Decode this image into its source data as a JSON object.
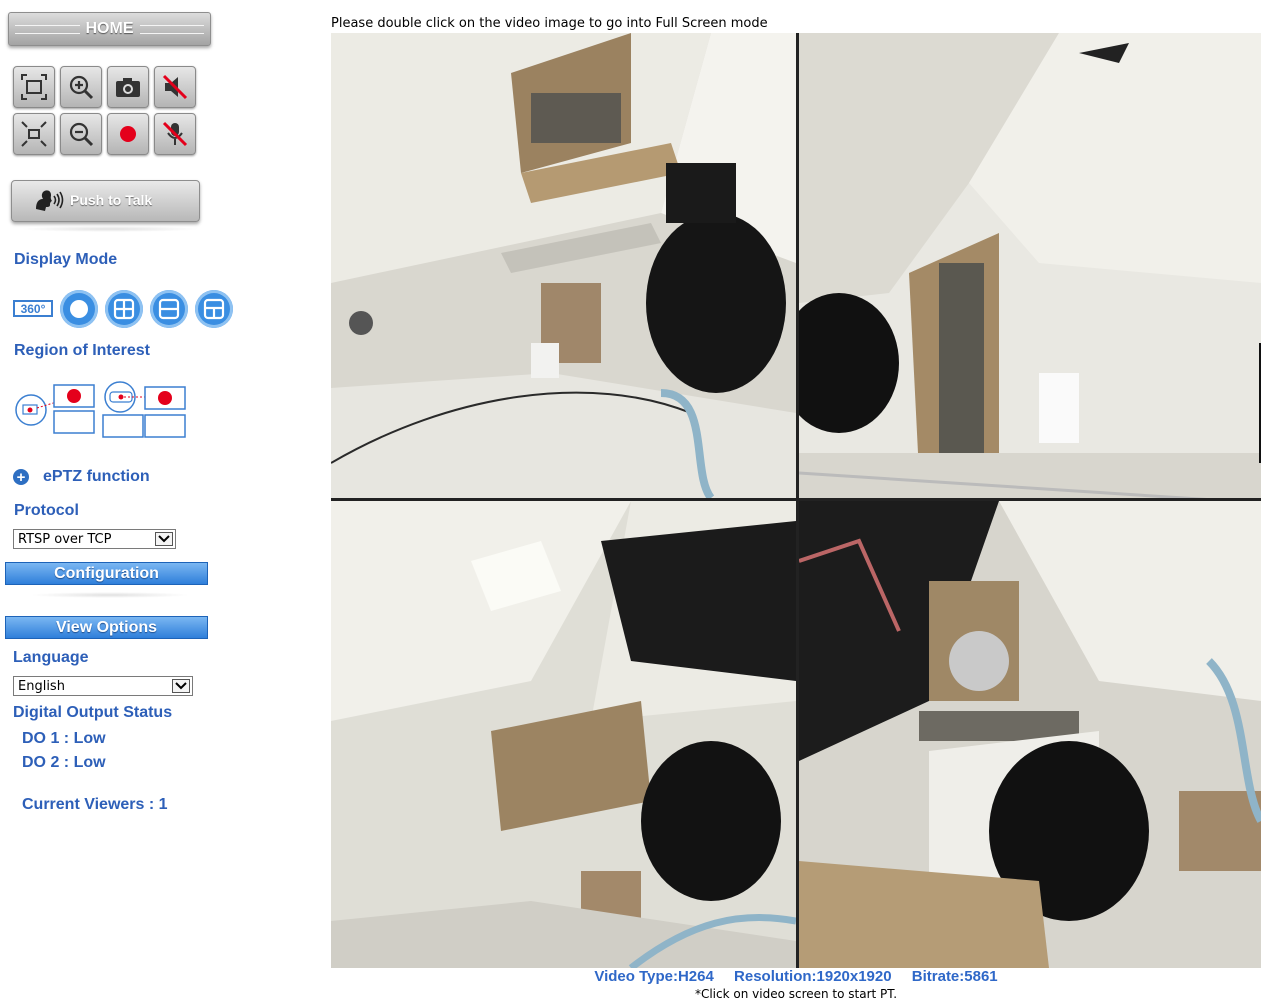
{
  "sidebar": {
    "home_label": "HOME",
    "push_to_talk_label": "Push to Talk",
    "display_mode_title": "Display Mode",
    "badge_360": "360°",
    "region_title": "Region of Interest",
    "eptz_label": "ePTZ function",
    "protocol_title": "Protocol",
    "protocol_value": "RTSP over TCP",
    "configuration_label": "Configuration",
    "view_options_label": "View Options",
    "language_title": "Language",
    "language_value": "English",
    "digital_output_title": "Digital Output Status",
    "do1": "DO 1 : Low",
    "do2": "DO 2 : Low",
    "current_viewers": "Current Viewers : 1"
  },
  "toolbar_icons": [
    "fullscreen-icon",
    "zoom-in-icon",
    "snapshot-icon",
    "mute-speaker-icon",
    "exit-fullscreen-icon",
    "zoom-out-icon",
    "record-icon",
    "mute-microphone-icon"
  ],
  "display_modes": [
    "fisheye-circle-icon",
    "quad-view-icon",
    "dual-panorama-icon",
    "split-view-icon"
  ],
  "video": {
    "notice": "Please double click on the video image to go into Full Screen mode",
    "video_type": "Video Type:H264",
    "resolution": "Resolution:1920x1920",
    "bitrate": "Bitrate:5861",
    "hint": "*Click on video screen to start PT."
  },
  "colors": {
    "accent_blue": "#2d5fb8",
    "button_blue": "#2f7fda",
    "record_red": "#e4001b"
  }
}
